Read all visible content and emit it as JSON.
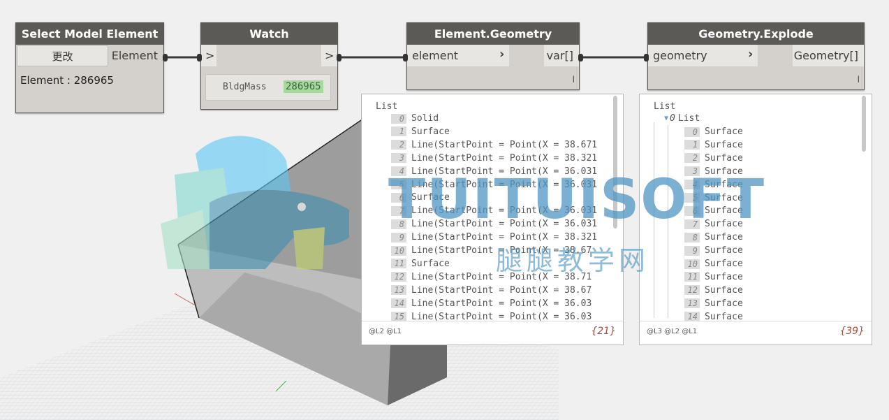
{
  "nodes": {
    "select": {
      "title": "Select Model Element",
      "button_label": "更改",
      "output_port": "Element",
      "element_text": "Element : 286965"
    },
    "watch": {
      "title": "Watch",
      "input_port": ">",
      "output_port": ">",
      "value_label": "BldgMass",
      "value": "286965"
    },
    "element_geometry": {
      "title": "Element.Geometry",
      "input_port": "element",
      "output_port": "var[]",
      "lacing": "l"
    },
    "geometry_explode": {
      "title": "Geometry.Explode",
      "input_port": "geometry",
      "output_port": "Geometry[]",
      "lacing": "l"
    }
  },
  "preview_left": {
    "header": "List",
    "items": [
      {
        "i": "0",
        "v": "Solid"
      },
      {
        "i": "1",
        "v": "Surface"
      },
      {
        "i": "2",
        "v": "Line(StartPoint = Point(X = 38.671"
      },
      {
        "i": "3",
        "v": "Line(StartPoint = Point(X = 38.321"
      },
      {
        "i": "4",
        "v": "Line(StartPoint = Point(X = 36.031"
      },
      {
        "i": "5",
        "v": "Line(StartPoint = Point(X = 36.031"
      },
      {
        "i": "6",
        "v": "Surface"
      },
      {
        "i": "7",
        "v": "Line(StartPoint = Point(X = 36.031"
      },
      {
        "i": "8",
        "v": "Line(StartPoint = Point(X = 36.031"
      },
      {
        "i": "9",
        "v": "Line(StartPoint = Point(X = 38.321"
      },
      {
        "i": "10",
        "v": "Line(StartPoint = Point(X = 38.67"
      },
      {
        "i": "11",
        "v": "Surface"
      },
      {
        "i": "12",
        "v": "Line(StartPoint = Point(X = 38.71"
      },
      {
        "i": "13",
        "v": "Line(StartPoint = Point(X = 38.67"
      },
      {
        "i": "14",
        "v": "Line(StartPoint = Point(X = 36.03"
      },
      {
        "i": "15",
        "v": "Line(StartPoint = Point(X = 36.03"
      }
    ],
    "levels": "@L2 @L1",
    "count": "{21}"
  },
  "preview_right": {
    "header": "List",
    "sublist_index": "0",
    "sublist_label": "List",
    "items": [
      {
        "i": "0",
        "v": "Surface"
      },
      {
        "i": "1",
        "v": "Surface"
      },
      {
        "i": "2",
        "v": "Surface"
      },
      {
        "i": "3",
        "v": "Surface"
      },
      {
        "i": "4",
        "v": "Surface"
      },
      {
        "i": "5",
        "v": "Surface"
      },
      {
        "i": "6",
        "v": "Surface"
      },
      {
        "i": "7",
        "v": "Surface"
      },
      {
        "i": "8",
        "v": "Surface"
      },
      {
        "i": "9",
        "v": "Surface"
      },
      {
        "i": "10",
        "v": "Surface"
      },
      {
        "i": "11",
        "v": "Surface"
      },
      {
        "i": "12",
        "v": "Surface"
      },
      {
        "i": "13",
        "v": "Surface"
      },
      {
        "i": "14",
        "v": "Surface"
      }
    ],
    "levels": "@L3 @L2 @L1",
    "count": "{39}"
  },
  "watermark": {
    "brand": "TUITUISOFT",
    "cn": "腿腿教学网"
  }
}
